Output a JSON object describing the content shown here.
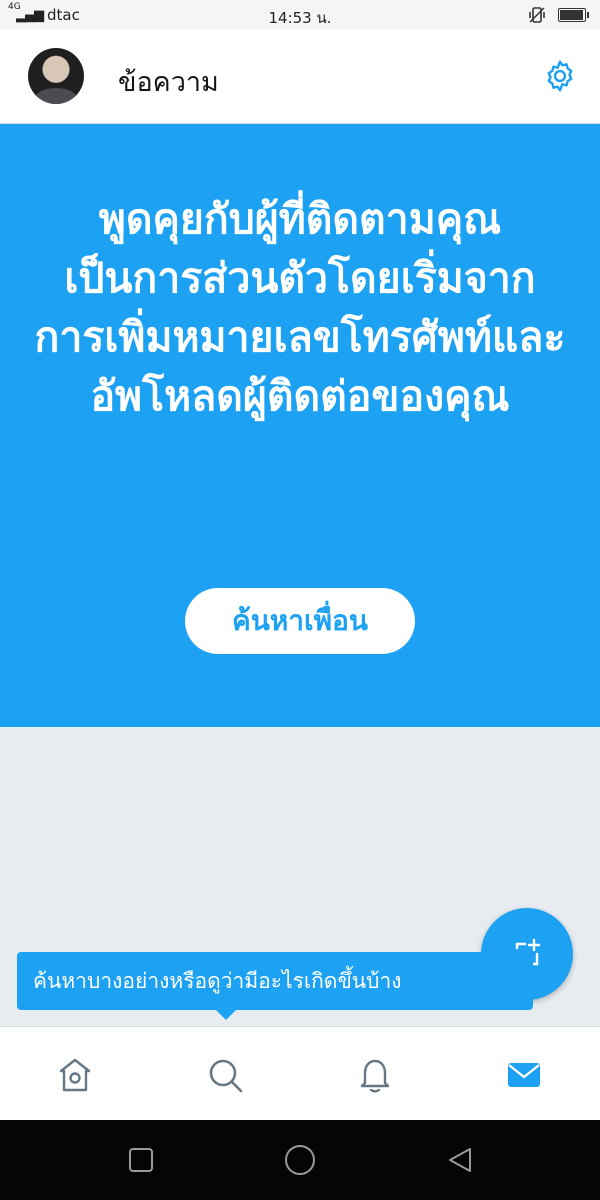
{
  "status_bar": {
    "network": "4G",
    "carrier": "dtac",
    "time": "14:53 น."
  },
  "header": {
    "title": "ข้อความ",
    "avatar_icon": "user-avatar",
    "settings_icon": "gear-icon"
  },
  "hero": {
    "message": "พูดคุยกับผู้ที่ติดตามคุณเป็นการส่วนตัวโดยเริ่มจากการเพิ่มหมายเลขโทรศัพท์และอัพโหลดผู้ติดต่อของคุณ",
    "button_label": "ค้นหาเพื่อน"
  },
  "fab": {
    "icon": "new-message-icon"
  },
  "tooltip": {
    "text": "ค้นหาบางอย่างหรือดูว่ามีอะไรเกิดขึ้นบ้าง"
  },
  "bottom_nav": {
    "items": [
      {
        "icon": "home-icon"
      },
      {
        "icon": "search-icon"
      },
      {
        "icon": "bell-icon"
      },
      {
        "icon": "mail-icon",
        "active": true
      }
    ]
  },
  "colors": {
    "accent": "#1da1f2",
    "inactive_icon": "#657786",
    "background": "#e6ecf0"
  },
  "battery_level": 0.9
}
